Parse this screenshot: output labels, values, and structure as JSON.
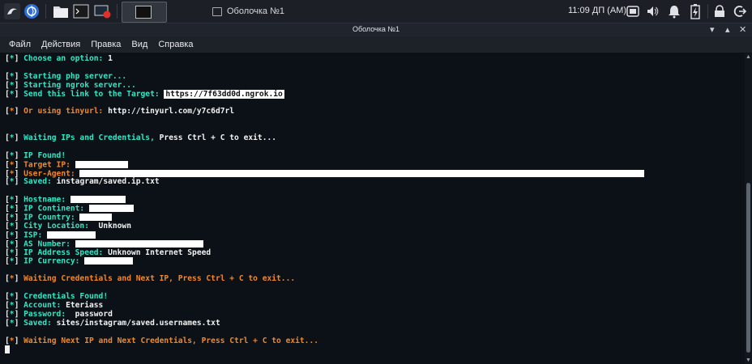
{
  "taskbar": {
    "task_title": "Оболочка №1",
    "clock": "11:09 ДП (AM)"
  },
  "window": {
    "title": "Оболочка №1"
  },
  "menu": [
    "Файл",
    "Действия",
    "Правка",
    "Вид",
    "Справка"
  ],
  "terminal": {
    "lines": [
      [
        {
          "t": "[",
          "c": "w"
        },
        {
          "t": "*",
          "c": "g"
        },
        {
          "t": "] ",
          "c": "w"
        },
        {
          "t": "Choose an option: ",
          "c": "g"
        },
        {
          "t": "1",
          "c": "w"
        }
      ],
      [],
      [
        {
          "t": "[",
          "c": "w"
        },
        {
          "t": "*",
          "c": "g"
        },
        {
          "t": "] ",
          "c": "w"
        },
        {
          "t": "Starting php server...",
          "c": "g"
        }
      ],
      [
        {
          "t": "[",
          "c": "w"
        },
        {
          "t": "*",
          "c": "g"
        },
        {
          "t": "] ",
          "c": "w"
        },
        {
          "t": "Starting ngrok server...",
          "c": "g"
        }
      ],
      [
        {
          "t": "[",
          "c": "w"
        },
        {
          "t": "*",
          "c": "g"
        },
        {
          "t": "] ",
          "c": "w"
        },
        {
          "t": "Send this link to the Target: ",
          "c": "g"
        },
        {
          "t": "https://7f63dd0d.ngrok.io",
          "c": "link"
        }
      ],
      [],
      [
        {
          "t": "[",
          "c": "w"
        },
        {
          "t": "*",
          "c": "o"
        },
        {
          "t": "] ",
          "c": "w"
        },
        {
          "t": "Or using tinyurl: ",
          "c": "o"
        },
        {
          "t": "http://tinyurl.com/y7c6d7rl",
          "c": "w"
        }
      ],
      [],
      [],
      [
        {
          "t": "[",
          "c": "w"
        },
        {
          "t": "*",
          "c": "g"
        },
        {
          "t": "] ",
          "c": "w"
        },
        {
          "t": "Waiting IPs and Credentials, ",
          "c": "g"
        },
        {
          "t": "Press Ctrl + C to exit...",
          "c": "w"
        }
      ],
      [],
      [
        {
          "t": "[",
          "c": "w"
        },
        {
          "t": "*",
          "c": "g"
        },
        {
          "t": "] ",
          "c": "w"
        },
        {
          "t": "IP Found!",
          "c": "g"
        }
      ],
      [
        {
          "t": "[",
          "c": "w"
        },
        {
          "t": "*",
          "c": "o"
        },
        {
          "t": "] ",
          "c": "w"
        },
        {
          "t": "Target IP: ",
          "c": "o"
        },
        {
          "r": 65
        }
      ],
      [
        {
          "t": "[",
          "c": "w"
        },
        {
          "t": "*",
          "c": "o"
        },
        {
          "t": "] ",
          "c": "w"
        },
        {
          "t": "User-Agent: ",
          "c": "o"
        },
        {
          "r": 697
        }
      ],
      [
        {
          "t": "[",
          "c": "w"
        },
        {
          "t": "*",
          "c": "g"
        },
        {
          "t": "] ",
          "c": "w"
        },
        {
          "t": "Saved: ",
          "c": "g"
        },
        {
          "t": "instagram/saved.ip.txt",
          "c": "w"
        }
      ],
      [],
      [
        {
          "t": "[",
          "c": "w"
        },
        {
          "t": "*",
          "c": "g"
        },
        {
          "t": "] ",
          "c": "w"
        },
        {
          "t": "Hostname: ",
          "c": "g"
        },
        {
          "r": 68
        }
      ],
      [
        {
          "t": "[",
          "c": "w"
        },
        {
          "t": "*",
          "c": "g"
        },
        {
          "t": "] ",
          "c": "w"
        },
        {
          "t": "IP Continent: ",
          "c": "g"
        },
        {
          "r": 55
        }
      ],
      [
        {
          "t": "[",
          "c": "w"
        },
        {
          "t": "*",
          "c": "g"
        },
        {
          "t": "] ",
          "c": "w"
        },
        {
          "t": "IP Country: ",
          "c": "g"
        },
        {
          "r": 40
        }
      ],
      [
        {
          "t": "[",
          "c": "w"
        },
        {
          "t": "*",
          "c": "g"
        },
        {
          "t": "] ",
          "c": "w"
        },
        {
          "t": "City Location: ",
          "c": "g"
        },
        {
          "t": " Unknown",
          "c": "w"
        }
      ],
      [
        {
          "t": "[",
          "c": "w"
        },
        {
          "t": "*",
          "c": "g"
        },
        {
          "t": "] ",
          "c": "w"
        },
        {
          "t": "ISP: ",
          "c": "g"
        },
        {
          "r": 60
        }
      ],
      [
        {
          "t": "[",
          "c": "w"
        },
        {
          "t": "*",
          "c": "g"
        },
        {
          "t": "] ",
          "c": "w"
        },
        {
          "t": "AS Number: ",
          "c": "g"
        },
        {
          "r": 158
        }
      ],
      [
        {
          "t": "[",
          "c": "w"
        },
        {
          "t": "*",
          "c": "g"
        },
        {
          "t": "] ",
          "c": "w"
        },
        {
          "t": "IP Address Speed: ",
          "c": "g"
        },
        {
          "t": "Unknown Internet Speed",
          "c": "w"
        }
      ],
      [
        {
          "t": "[",
          "c": "w"
        },
        {
          "t": "*",
          "c": "g"
        },
        {
          "t": "] ",
          "c": "w"
        },
        {
          "t": "IP Currency: ",
          "c": "g"
        },
        {
          "r": 60
        }
      ],
      [],
      [
        {
          "t": "[",
          "c": "w"
        },
        {
          "t": "*",
          "c": "o"
        },
        {
          "t": "] ",
          "c": "w"
        },
        {
          "t": "Waiting Credentials and Next IP, Press Ctrl + C to exit...",
          "c": "o"
        }
      ],
      [],
      [
        {
          "t": "[",
          "c": "w"
        },
        {
          "t": "*",
          "c": "g"
        },
        {
          "t": "] ",
          "c": "w"
        },
        {
          "t": "Credentials Found!",
          "c": "g"
        }
      ],
      [
        {
          "t": "[",
          "c": "w"
        },
        {
          "t": "*",
          "c": "g"
        },
        {
          "t": "] ",
          "c": "w"
        },
        {
          "t": "Account: ",
          "c": "g"
        },
        {
          "t": "Eteriass",
          "c": "w"
        }
      ],
      [
        {
          "t": "[",
          "c": "w"
        },
        {
          "t": "*",
          "c": "g"
        },
        {
          "t": "] ",
          "c": "w"
        },
        {
          "t": "Password: ",
          "c": "g"
        },
        {
          "t": " password",
          "c": "w"
        }
      ],
      [
        {
          "t": "[",
          "c": "w"
        },
        {
          "t": "*",
          "c": "g"
        },
        {
          "t": "] ",
          "c": "w"
        },
        {
          "t": "Saved: ",
          "c": "g"
        },
        {
          "t": "sites/instagram/saved.usernames.txt",
          "c": "w"
        }
      ],
      [],
      [
        {
          "t": "[",
          "c": "w"
        },
        {
          "t": "*",
          "c": "o"
        },
        {
          "t": "] ",
          "c": "w"
        },
        {
          "t": "Waiting Next IP and Next Credentials, Press Ctrl + C to exit...",
          "c": "o"
        }
      ],
      [
        {
          "cursor": true
        }
      ]
    ]
  },
  "colors": {
    "cyan": "#32e6c4",
    "orange": "#f0882a",
    "white": "#f2f2f2",
    "panel": "#1c1f26",
    "terminal_bg": "#0c1117"
  }
}
